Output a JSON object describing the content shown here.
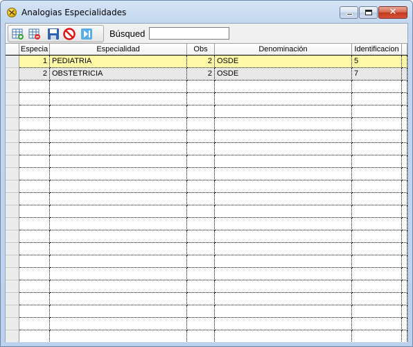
{
  "window": {
    "title": "Analogias Especialidades",
    "icon": "app-icon",
    "controls": {
      "minimize_icon": "minimize-icon",
      "maximize_icon": "maximize-icon",
      "close_label": "✕"
    }
  },
  "toolbar": {
    "buttons": [
      {
        "name": "add-record-button",
        "icon": "grid-add-icon"
      },
      {
        "name": "delete-record-button",
        "icon": "grid-delete-icon"
      },
      {
        "name": "save-button",
        "icon": "floppy-disk-icon"
      },
      {
        "name": "cancel-button",
        "icon": "no-entry-icon"
      },
      {
        "name": "last-record-button",
        "icon": "skip-forward-icon"
      }
    ],
    "search_label": "Búsqued",
    "search_value": ""
  },
  "grid": {
    "columns": [
      "Especia",
      "Especialidad",
      "Obs",
      "Denominación",
      "Identificacion"
    ],
    "rows": [
      {
        "especia": "1",
        "especialidad": "PEDIATRIA",
        "obs": "2",
        "denominacion": "OSDE",
        "identificacion": "5"
      },
      {
        "especia": "2",
        "especialidad": "OBSTETRICIA",
        "obs": "2",
        "denominacion": "OSDE",
        "identificacion": "7"
      }
    ],
    "selected_row": 0,
    "colors": {
      "selected": "#fff8a6",
      "alternate": "#e8e8e8",
      "header": "#f1f1f1"
    }
  }
}
